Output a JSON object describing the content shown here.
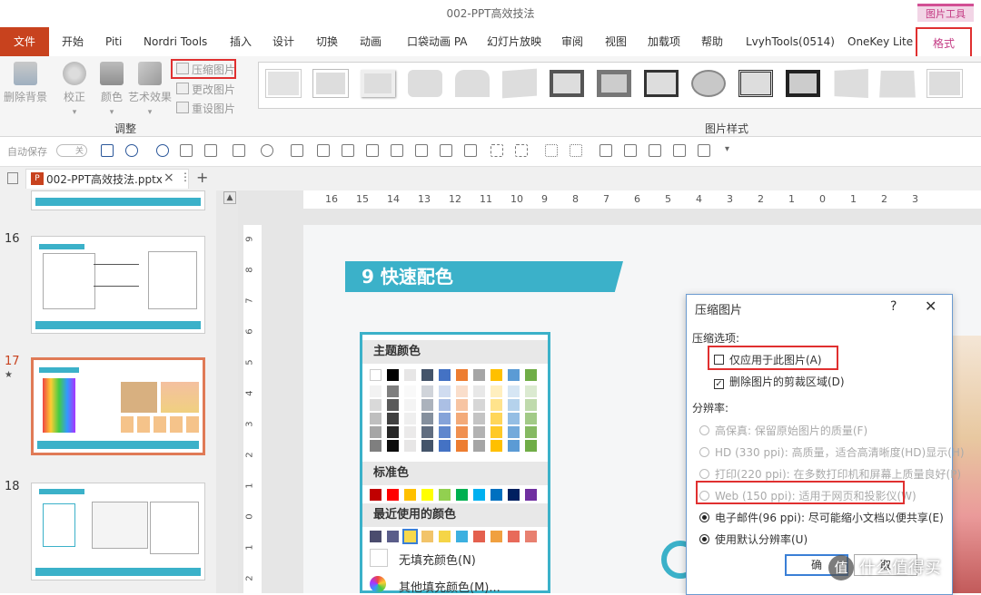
{
  "window": {
    "title": "002-PPT高效技法",
    "context_tab_group": "图片工具"
  },
  "tabs": [
    "文件",
    "开始",
    "Piti",
    "Nordri Tools",
    "插入",
    "设计",
    "切换",
    "动画",
    "口袋动画 PA",
    "幻灯片放映",
    "审阅",
    "视图",
    "加载项",
    "帮助",
    "LvyhTools(0514)",
    "OneKey Lite",
    "格式"
  ],
  "ribbon": {
    "adjust": {
      "remove_bg": "删除背景",
      "correct": "校正",
      "color": "颜色",
      "art_effects": "艺术效果",
      "compress": "压缩图片",
      "change": "更改图片",
      "reset": "重设图片",
      "group_label": "调整"
    },
    "styles_group_label": "图片样式"
  },
  "qat": {
    "autosave": "自动保存",
    "toggle": "关"
  },
  "file_tab": {
    "name": "002-PPT高效技法.pptx",
    "close": "×",
    "add": "+"
  },
  "slides": [
    {
      "num": "16"
    },
    {
      "num": "17",
      "mark": "★"
    },
    {
      "num": "18"
    }
  ],
  "ruler": {
    "h_ticks": [
      "16",
      "15",
      "14",
      "13",
      "12",
      "11",
      "10",
      "9",
      "8",
      "7",
      "6",
      "5",
      "4",
      "3",
      "2",
      "1",
      "0",
      "1",
      "2",
      "3"
    ],
    "v_ticks": [
      "9",
      "8",
      "7",
      "6",
      "5",
      "4",
      "3",
      "2",
      "1",
      "0",
      "1",
      "2"
    ]
  },
  "slide": {
    "heading": "9  快速配色"
  },
  "color_picker": {
    "theme_title": "主题颜色",
    "standard_title": "标准色",
    "recent_title": "最近使用的颜色",
    "no_fill": "无填充颜色(N)",
    "more_fill": "其他填充颜色(M)...",
    "theme_top": [
      "#ffffff",
      "#000000",
      "#e7e6e6",
      "#44546a",
      "#4472c4",
      "#ed7d31",
      "#a5a5a5",
      "#ffc000",
      "#5b9bd5",
      "#70ad47"
    ],
    "standard": [
      "#c00000",
      "#ff0000",
      "#ffc000",
      "#ffff00",
      "#92d050",
      "#00b050",
      "#00b0f0",
      "#0070c0",
      "#002060",
      "#7030a0"
    ],
    "recent": [
      "#4b4c6e",
      "#5a5d8a",
      "#f7d94c",
      "#f2c46a",
      "#f5d547",
      "#3cb0e0",
      "#e4604e",
      "#f0a040",
      "#e86a5a",
      "#e88070"
    ]
  },
  "dialog": {
    "title": "压缩图片",
    "help": "?",
    "close": "✕",
    "options_label": "压缩选项:",
    "opt_apply_only": "仅应用于此图片(A)",
    "opt_delete_crop": "删除图片的剪裁区域(D)",
    "opt_delete_crop_checked": "✓",
    "resolution_label": "分辨率:",
    "res_hifi": "高保真: 保留原始图片的质量(F)",
    "res_hd": "HD (330 ppi): 高质量，适合高清晰度(HD)显示(H)",
    "res_print": "打印(220 ppi): 在多数打印机和屏幕上质量良好(P)",
    "res_web": "Web (150 ppi): 适用于网页和投影仪(W)",
    "res_email": "电子邮件(96 ppi): 尽可能缩小文档以便共享(E)",
    "res_default": "使用默认分辨率(U)",
    "ok": "确",
    "cancel": "取"
  },
  "watermark": {
    "logo": "值",
    "text": "什么值得买"
  }
}
